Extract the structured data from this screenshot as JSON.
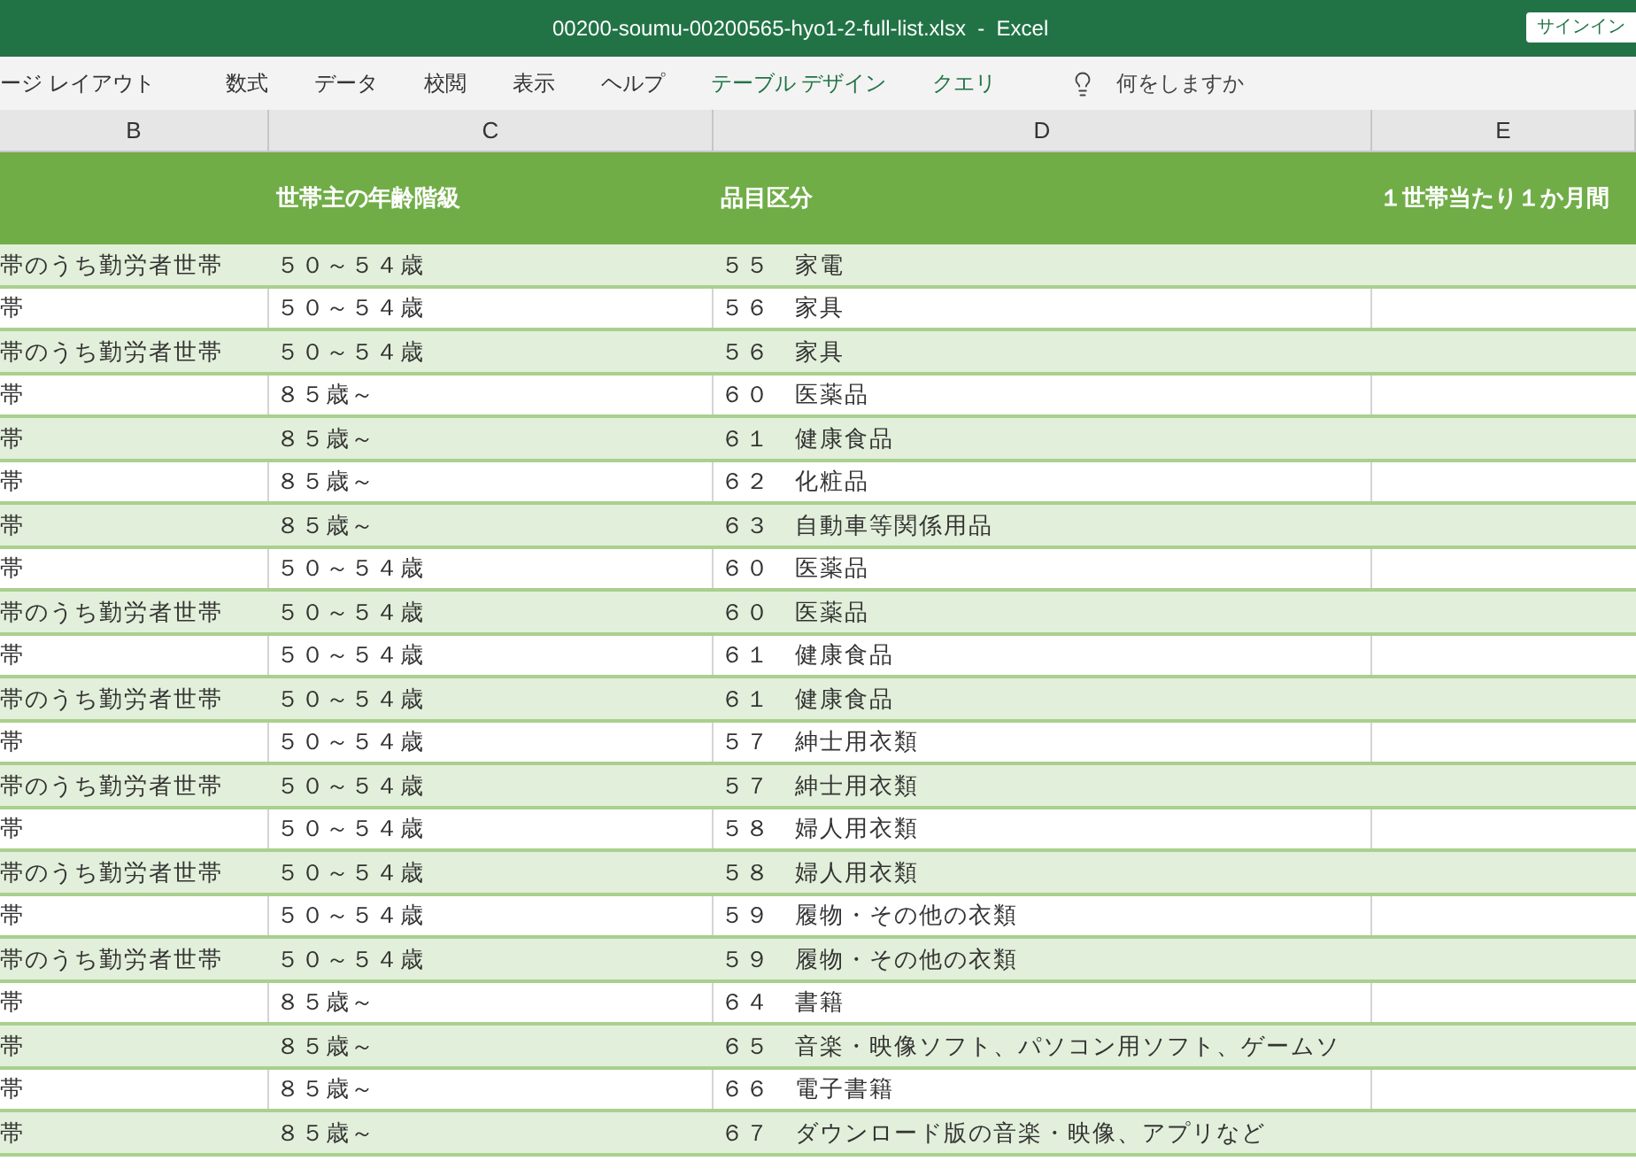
{
  "window": {
    "title": "00200-soumu-00200565-hyo1-2-full-list.xlsx  -  Excel",
    "sign_in": "サインイン"
  },
  "ribbon_tabs": [
    {
      "label": "ージ レイアウト",
      "kind": "normal"
    },
    {
      "label": "数式",
      "kind": "normal"
    },
    {
      "label": "データ",
      "kind": "normal"
    },
    {
      "label": "校閲",
      "kind": "normal"
    },
    {
      "label": "表示",
      "kind": "normal"
    },
    {
      "label": "ヘルプ",
      "kind": "normal"
    },
    {
      "label": "テーブル デザイン",
      "kind": "contextual"
    },
    {
      "label": "クエリ",
      "kind": "contextual"
    }
  ],
  "tell_me": {
    "placeholder": "何をしますか"
  },
  "column_letters": [
    "B",
    "C",
    "D",
    "E"
  ],
  "table": {
    "columns": [
      "",
      "世帯主の年齢階級",
      "品目区分",
      "１世帯当たり１か月間"
    ],
    "rows": [
      [
        "帯のうち勤労者世帯",
        "５０～５４歳",
        "５５　家電",
        ""
      ],
      [
        "帯",
        "５０～５４歳",
        "５６　家具",
        ""
      ],
      [
        "帯のうち勤労者世帯",
        "５０～５４歳",
        "５６　家具",
        ""
      ],
      [
        "帯",
        "８５歳～",
        "６０　医薬品",
        ""
      ],
      [
        "帯",
        "８５歳～",
        "６１　健康食品",
        ""
      ],
      [
        "帯",
        "８５歳～",
        "６２　化粧品",
        ""
      ],
      [
        "帯",
        "８５歳～",
        "６３　自動車等関係用品",
        ""
      ],
      [
        "帯",
        "５０～５４歳",
        "６０　医薬品",
        ""
      ],
      [
        "帯のうち勤労者世帯",
        "５０～５４歳",
        "６０　医薬品",
        ""
      ],
      [
        "帯",
        "５０～５４歳",
        "６１　健康食品",
        ""
      ],
      [
        "帯のうち勤労者世帯",
        "５０～５４歳",
        "６１　健康食品",
        ""
      ],
      [
        "帯",
        "５０～５４歳",
        "５７　紳士用衣類",
        ""
      ],
      [
        "帯のうち勤労者世帯",
        "５０～５４歳",
        "５７　紳士用衣類",
        ""
      ],
      [
        "帯",
        "５０～５４歳",
        "５８　婦人用衣類",
        ""
      ],
      [
        "帯のうち勤労者世帯",
        "５０～５４歳",
        "５８　婦人用衣類",
        ""
      ],
      [
        "帯",
        "５０～５４歳",
        "５９　履物・その他の衣類",
        ""
      ],
      [
        "帯のうち勤労者世帯",
        "５０～５４歳",
        "５９　履物・その他の衣類",
        ""
      ],
      [
        "帯",
        "８５歳～",
        "６４　書籍",
        ""
      ],
      [
        "帯",
        "８５歳～",
        "６５　音楽・映像ソフト、パソコン用ソフト、ゲームソ",
        ""
      ],
      [
        "帯",
        "８５歳～",
        "６６　電子書籍",
        ""
      ],
      [
        "帯",
        "８５歳～",
        "６７　ダウンロード版の音楽・映像、アプリなど",
        ""
      ]
    ]
  }
}
